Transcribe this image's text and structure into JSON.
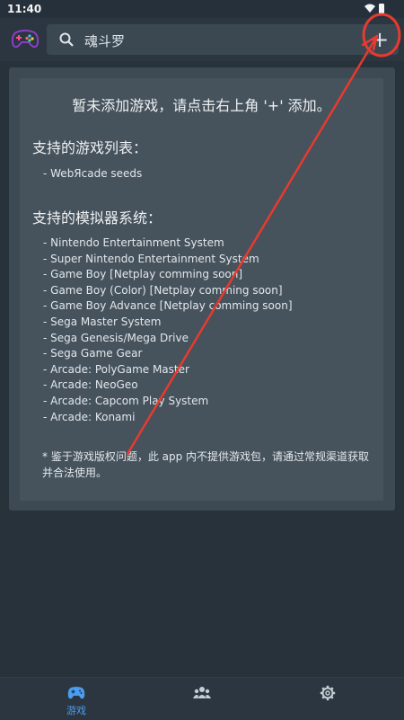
{
  "status_bar": {
    "time": "11:40"
  },
  "search": {
    "value": "魂斗罗",
    "icon": "search-icon"
  },
  "toolbar": {
    "add_label": "+"
  },
  "card": {
    "title": "暂未添加游戏，请点击右上角 '+' 添加。",
    "games_heading": "支持的游戏列表：",
    "games": [
      "- WebЯcade seeds"
    ],
    "systems_heading": "支持的模拟器系统：",
    "systems": [
      "- Nintendo Entertainment System",
      "- Super Nintendo Entertainment System",
      "- Game Boy [Netplay comming soon]",
      "- Game Boy (Color) [Netplay comming soon]",
      "- Game Boy Advance [Netplay comming soon]",
      "- Sega Master System",
      "- Sega Genesis/Mega Drive",
      "- Sega Game Gear",
      "- Arcade: PolyGame Master",
      "- Arcade: NeoGeo",
      "- Arcade: Capcom Play System",
      "- Arcade: Konami"
    ],
    "disclaimer": "* 鉴于游戏版权问题，此 app 内不提供游戏包，请通过常规渠道获取并合法使用。"
  },
  "bottom_nav": {
    "games_label": "游戏",
    "active_color": "#4a9df0",
    "inactive_color": "#c6ced5"
  },
  "colors": {
    "background": "#28323b",
    "appbar": "#2b3640",
    "card_outer": "#3d4953",
    "card_inner": "#46525c",
    "annotation": "#e83a2e"
  }
}
